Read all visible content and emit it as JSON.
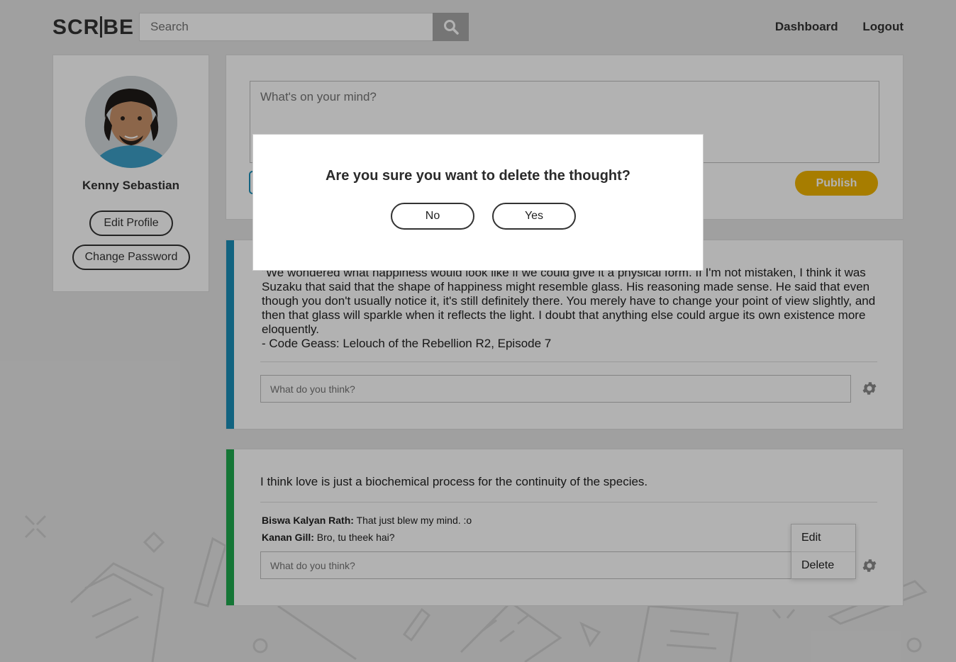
{
  "header": {
    "logo": "SCRIBE",
    "search_placeholder": "Search",
    "nav": [
      "Dashboard",
      "Logout"
    ]
  },
  "profile": {
    "name": "Kenny Sebastian",
    "edit_profile": "Edit Profile",
    "change_password": "Change Password"
  },
  "composer": {
    "placeholder": "What's on your mind?",
    "publish": "Publish"
  },
  "thoughts": [
    {
      "text": "\"We wondered what happiness would look like if we could give it a physical form. If I'm not mistaken, I think it was Suzaku that said that the shape of happiness might resemble glass. His reasoning made sense. He said that even though you don't usually notice it, it's still definitely there. You merely have to change your point of view slightly, and then that glass will sparkle when it reflects the light. I doubt that anything else could argue its own existence more eloquently.\n- Code Geass: Lelouch of the Rebellion R2, Episode 7",
      "comment_placeholder": "What do you think?",
      "accent": "#1a8fb8"
    },
    {
      "text": "I think love is just a biochemical process for the continuity of the species.",
      "comment_placeholder": "What do you think?",
      "accent": "#1faa4e",
      "comments": [
        {
          "author": "Biswa Kalyan Rath:",
          "text": "That just blew my mind. :o"
        },
        {
          "author": "Kanan Gill:",
          "text": "Bro, tu theek hai?"
        }
      ]
    }
  ],
  "menu": {
    "edit": "Edit",
    "delete": "Delete"
  },
  "modal": {
    "title": "Are you sure you want to delete the thought?",
    "no": "No",
    "yes": "Yes"
  },
  "colors": {
    "publish": "#f0b400",
    "accent_blue": "#1a8fb8",
    "accent_green": "#1faa4e"
  }
}
